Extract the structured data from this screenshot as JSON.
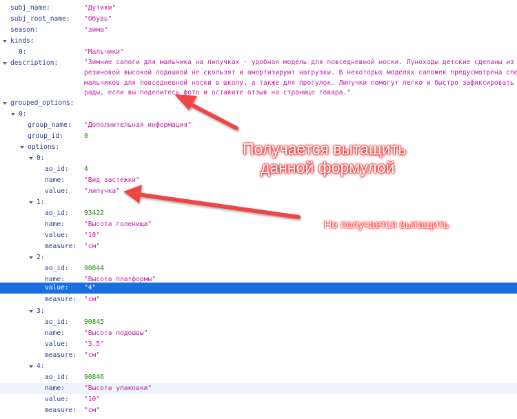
{
  "json_viewer": {
    "subj_name": {
      "key": "subj_name:",
      "value": "\"Дутики\""
    },
    "subj_root_name": {
      "key": "subj_root_name:",
      "value": "\"Обувь\""
    },
    "season": {
      "key": "season:",
      "value": "\"зима\""
    },
    "kinds": {
      "key": "kinds:",
      "items": [
        {
          "key": "0:",
          "value": "\"Мальчики\""
        }
      ]
    },
    "description": {
      "key": "description:",
      "lines": [
        "\"Зимние сапоги для мальчика на липучках - удобная модель для повседневной носки. Луноходы детские сделаны из текстиля и экокожи: т",
        "резиновой высокой подошвой не скользят и амортизируют нагрузки. В некоторых моделях сапожек предусмотрена специальная антигололедн",
        "мальчиков для повседневной носки в школу, а также для прогулок. Липучки помогут легко и быстро зафиксировать обувь на ноге, а дуты",
        "рады, если вы поделитесь фото и оставите отзыв на странице товара.\""
      ]
    },
    "grouped_options": {
      "key": "grouped_options:",
      "group": {
        "index_key": "0:",
        "group_name": {
          "key": "group_name:",
          "value": "\"Дополнительная информация\""
        },
        "group_id": {
          "key": "group_id:",
          "value": "0"
        },
        "options_key": "options:",
        "options": [
          {
            "index_key": "0:",
            "ao_id": {
              "key": "ao_id:",
              "value": "4"
            },
            "name": {
              "key": "name:",
              "value": "\"Вид застежки\""
            },
            "value": {
              "key": "value:",
              "value": "\"липучка\""
            }
          },
          {
            "index_key": "1:",
            "ao_id": {
              "key": "ao_id:",
              "value": "93422"
            },
            "name": {
              "key": "name:",
              "value": "\"Высота голенища\""
            },
            "value": {
              "key": "value:",
              "value": "\"18\""
            },
            "measure": {
              "key": "measure:",
              "value": "\"см\""
            }
          },
          {
            "index_key": "2:",
            "ao_id": {
              "key": "ao_id:",
              "value": "90844"
            },
            "name": {
              "key": "name:",
              "value": "\"Высота платформы\""
            },
            "value": {
              "key": "value:",
              "value": "\"4\""
            },
            "measure": {
              "key": "measure:",
              "value": "\"см\""
            }
          },
          {
            "index_key": "3:",
            "ao_id": {
              "key": "ao_id:",
              "value": "90845"
            },
            "name": {
              "key": "name:",
              "value": "\"Высота подошвы\""
            },
            "value": {
              "key": "value:",
              "value": "\"3.5\""
            },
            "measure": {
              "key": "measure:",
              "value": "\"см\""
            }
          },
          {
            "index_key": "4:",
            "ao_id": {
              "key": "ao_id:",
              "value": "90846"
            },
            "name": {
              "key": "name:",
              "value": "\"Высота упаковки\""
            },
            "value": {
              "key": "value:",
              "value": "\"10\""
            },
            "measure": {
              "key": "measure:",
              "value": "\"см\""
            }
          }
        ]
      }
    }
  },
  "annotations": {
    "works_line1": "Получается вытащить",
    "works_line2": "данной формулой",
    "fails": "Не получается вытащить"
  },
  "colors": {
    "key": "#2d3a8c",
    "string": "#c21ca8",
    "number": "#1a8a00",
    "selected_row": "#1a6fe0",
    "hover_row": "#eef4fb",
    "arrow": "#f04545"
  }
}
